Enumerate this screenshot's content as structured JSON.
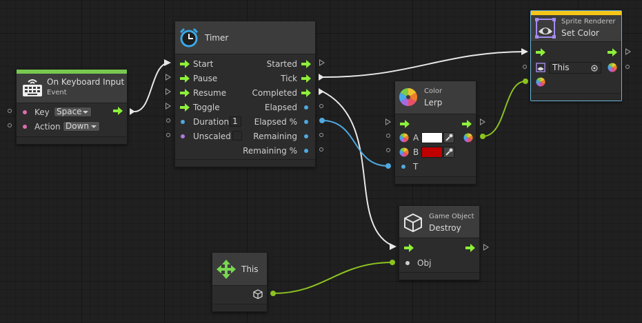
{
  "colors": {
    "control_flow": "#8df03a",
    "object_wire": "#8cc320",
    "float_wire": "#4fa9e0",
    "keyboard_header": "#78c850",
    "sprite_header": "#f5c518",
    "selection": "#6fb6dc"
  },
  "keyboard_node": {
    "title": "On Keyboard Input",
    "subtitle": "Event",
    "icon": "keyboard-icon",
    "key_label": "Key",
    "key_value": "Space",
    "action_label": "Action",
    "action_value": "Down"
  },
  "timer_node": {
    "title": "Timer",
    "icon": "alarm-clock-icon",
    "inputs": [
      "Start",
      "Pause",
      "Resume",
      "Toggle"
    ],
    "duration_label": "Duration",
    "duration_value": "1",
    "unscaled_label": "Unscaled",
    "outputs": [
      "Started",
      "Tick",
      "Completed",
      "Elapsed",
      "Elapsed %",
      "Remaining",
      "Remaining %"
    ]
  },
  "lerp_node": {
    "title": "Lerp",
    "subtitle": "Color",
    "icon": "color-wheel-icon",
    "a_label": "A",
    "b_label": "B",
    "t_label": "T",
    "a_color": "#ffffff",
    "b_color": "#c00000"
  },
  "sprite_node": {
    "title": "Set Color",
    "subtitle": "Sprite Renderer",
    "icon": "sprite-renderer-icon",
    "target_value": "This"
  },
  "destroy_node": {
    "title": "Destroy",
    "subtitle": "Game Object",
    "icon": "cube-icon",
    "obj_label": "Obj"
  },
  "this_node": {
    "title": "This",
    "icon": "move-arrows-icon"
  }
}
